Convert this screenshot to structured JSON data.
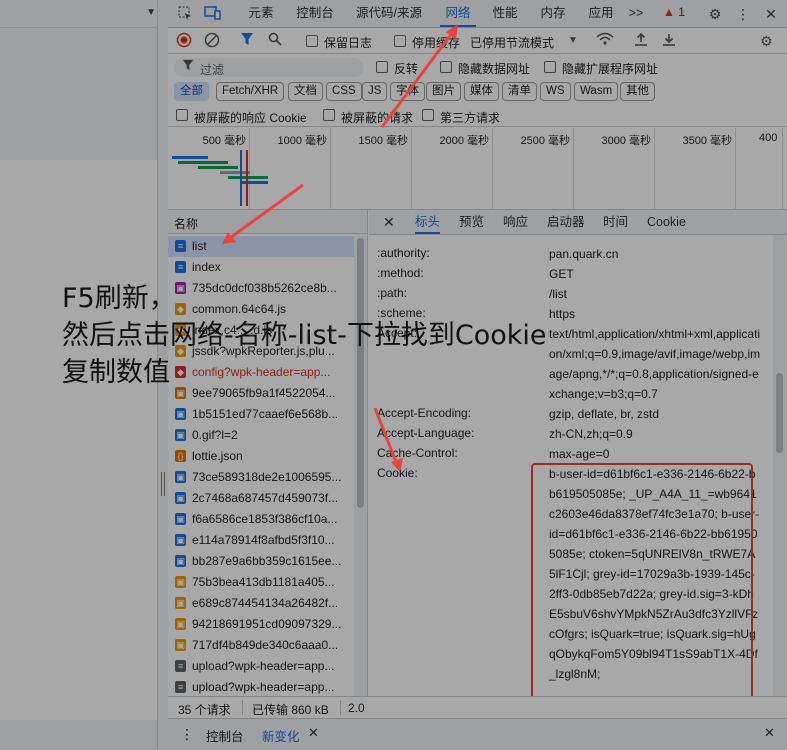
{
  "devtools": {
    "tabs": [
      "元素",
      "控制台",
      "源代码/来源",
      "网络",
      "性能",
      "内存",
      "应用"
    ],
    "active_tab": "网络",
    "more_tabs": ">>",
    "warning_count": "1",
    "toolbar": {
      "preserve_log": "保留日志",
      "disable_cache": "停用缓存",
      "throttling": "已停用节流模式"
    },
    "filter": {
      "placeholder": "过滤",
      "invert": "反转",
      "hide_data_urls": "隐藏数据网址",
      "hide_extension_urls": "隐藏扩展程序网址"
    },
    "type_filters": [
      "全部",
      "Fetch/XHR",
      "文档",
      "CSS",
      "JS",
      "字体",
      "图片",
      "媒体",
      "清单",
      "WS",
      "Wasm",
      "其他"
    ],
    "options": {
      "blocked_cookies": "被屏蔽的响应 Cookie",
      "blocked_requests": "被屏蔽的请求",
      "third_party": "第三方请求"
    },
    "timeline_ticks": [
      "500 毫秒",
      "1000 毫秒",
      "1500 毫秒",
      "2000 毫秒",
      "2500 毫秒",
      "3000 毫秒",
      "3500 毫秒",
      "400"
    ],
    "list": {
      "header": "名称",
      "items": [
        {
          "name": "list",
          "kind": "doc",
          "color": "#1a73e8"
        },
        {
          "name": "index",
          "kind": "doc",
          "color": "#1a73e8"
        },
        {
          "name": "735dc0dcf038b5262ce8b...",
          "kind": "img",
          "color": "#9c27b0"
        },
        {
          "name": "common.64c64.js",
          "kind": "js",
          "color": "#f29900"
        },
        {
          "name": "index.c4... .d.js",
          "kind": "js",
          "color": "#f29900"
        },
        {
          "name": "jssdk?wpkReporter.js,plu...",
          "kind": "js",
          "color": "#f29900"
        },
        {
          "name": "config?wpk-header=app...",
          "kind": "err",
          "color": "#d93025"
        },
        {
          "name": "9ee79065fb9a1f4522054...",
          "kind": "img",
          "color": "#e37400"
        },
        {
          "name": "1b5151ed77caaef6e568b...",
          "kind": "img",
          "color": "#1a73e8"
        },
        {
          "name": "0.gif?l=2",
          "kind": "img",
          "color": "#1a73e8"
        },
        {
          "name": "lottie.json",
          "kind": "xhr",
          "color": "#e37400"
        },
        {
          "name": "73ce589318de2e1006595...",
          "kind": "img",
          "color": "#1a73e8"
        },
        {
          "name": "2c7468a687457d459073f...",
          "kind": "img",
          "color": "#1a73e8"
        },
        {
          "name": "f6a6586ce1853f386cf10a...",
          "kind": "img",
          "color": "#1a73e8"
        },
        {
          "name": "e114a78914f8afbd5f3f10...",
          "kind": "img",
          "color": "#1a73e8"
        },
        {
          "name": "bb287e9a6bb359c1615ee...",
          "kind": "img",
          "color": "#1a73e8"
        },
        {
          "name": "75b3bea413db1181a405...",
          "kind": "img",
          "color": "#f29900"
        },
        {
          "name": "e689c874454134a26482f...",
          "kind": "img",
          "color": "#f29900"
        },
        {
          "name": "94218691951cd09097329...",
          "kind": "img",
          "color": "#f29900"
        },
        {
          "name": "717df4b849de340c6aaa0...",
          "kind": "img",
          "color": "#f29900"
        },
        {
          "name": "upload?wpk-header=app...",
          "kind": "doc",
          "color": "#5f6368"
        },
        {
          "name": "upload?wpk-header=app...",
          "kind": "doc",
          "color": "#5f6368"
        }
      ]
    },
    "details": {
      "tabs": [
        "标头",
        "预览",
        "响应",
        "启动器",
        "时间",
        "Cookie"
      ],
      "active_tab": "标头",
      "headers": [
        {
          "key": ":authority:",
          "value": "pan.quark.cn"
        },
        {
          "key": ":method:",
          "value": "GET"
        },
        {
          "key": ":path:",
          "value": "/list"
        },
        {
          "key": ":scheme:",
          "value": "https"
        },
        {
          "key": "Accept:",
          "value": "text/html,application/xhtml+xml,application/xml;q=0.9,image/avif,image/webp,image/apng,*/*;q=0.8,application/signed-exchange;v=b3;q=0.7"
        },
        {
          "key": "Accept-Encoding:",
          "value": "gzip, deflate, br, zstd"
        },
        {
          "key": "Accept-Language:",
          "value": "zh-CN,zh;q=0.9"
        },
        {
          "key": "Cache-Control:",
          "value": "max-age=0"
        },
        {
          "key": "Cookie:",
          "value": "b-user-id=d61bf6c1-e336-2146-6b22-bb619505085e; _UP_A4A_11_=wb9641c2603e46da8378ef74fc3e1a70; b-user-id=d61bf6c1-e336-2146-6b22-bb619505085e; ctoken=5qUNRElV8n_tRWE7A5lF1Cjl; grey-id=17029a3b-1939-145c-2ff3-0db85eb7d22a; grey-id.sig=3-kDhE5sbuV6shvYMpkN5ZrAu3dfc3YzllVFzcOfgrs; isQuark=true; isQuark.sig=hUgqObykqFom5Y09bl94T1sS9abT1X-4Df_lzgl8nM;"
        }
      ]
    },
    "status": {
      "requests": "35 个请求",
      "transferred": "已传输 860 kB",
      "extra": "2.0"
    },
    "drawer": {
      "tabs": [
        "控制台",
        "新变化"
      ],
      "active_tab": "新变化"
    }
  },
  "annotation": {
    "lines": [
      "F5刷新，",
      "然后点击网络-名称-list-下拉找到Cookie",
      "复制数值"
    ],
    "color": "#e8453c"
  }
}
